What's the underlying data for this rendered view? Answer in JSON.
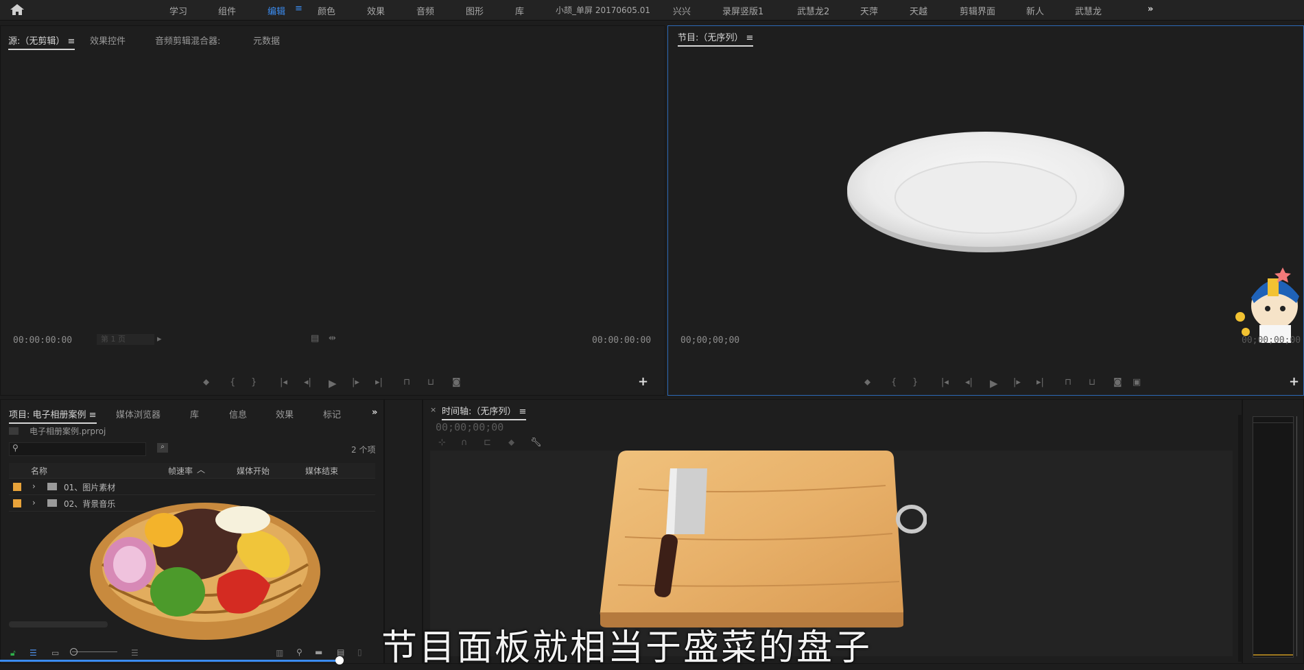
{
  "topbar": {
    "workspaces": [
      "学习",
      "组件",
      "编辑",
      "颜色",
      "效果",
      "音频",
      "图形",
      "库",
      "小颉_单屏 20170605.01",
      "兴兴",
      "录屏竖版1",
      "武慧龙2",
      "天萍",
      "天越",
      "剪辑界面",
      "新人",
      "武慧龙"
    ],
    "active": "编辑",
    "overflow": "»"
  },
  "source_panel": {
    "tabs": [
      "源:（无剪辑）",
      "效果控件",
      "音频剪辑混合器:",
      "元数据"
    ],
    "timecode_left": "00:00:00:00",
    "page_select": "第 1 页",
    "timecode_right": "00:00:00:00"
  },
  "program_panel": {
    "title": "节目:（无序列）",
    "timecode_left": "00;00;00;00",
    "timecode_right": "00;00;00;00"
  },
  "project_panel": {
    "tabs": [
      "项目: 电子相册案例",
      "媒体浏览器",
      "库",
      "信息",
      "效果",
      "标记"
    ],
    "file": "电子相册案例.prproj",
    "item_count": "2 个项",
    "columns": [
      "名称",
      "帧速率",
      "媒体开始",
      "媒体结束"
    ],
    "rows": [
      {
        "name": "01、图片素材",
        "color": "#e8a33a"
      },
      {
        "name": "02、背景音乐",
        "color": "#e8a33a"
      }
    ]
  },
  "timeline_panel": {
    "title": "时间轴:（无序列）",
    "timecode": "00;00;00;00"
  },
  "tools": [
    "selection-tool",
    "track-select-tool",
    "ripple-edit-tool",
    "razor-tool",
    "slip-tool",
    "pen-tool",
    "hand-tool",
    "type-tool"
  ],
  "overlay_subtitle": "节目面板就相当于盛菜的盘子",
  "colors": {
    "accent": "#3b8cf0",
    "label": "#e8a33a",
    "panel": "#1e1e1e"
  }
}
